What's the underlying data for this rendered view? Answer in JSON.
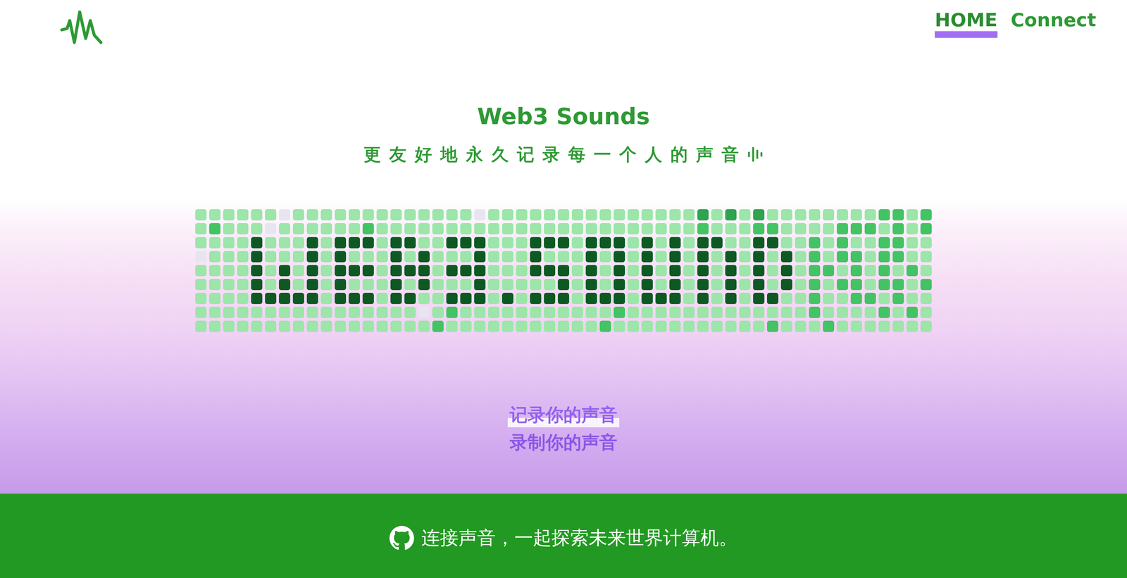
{
  "header": {
    "nav": [
      {
        "label": "HOME",
        "selected": true
      },
      {
        "label": "Connect",
        "selected": false
      }
    ]
  },
  "hero": {
    "title": "Web3 Sounds",
    "subtitle": "更友好地永久记录每一个人的声音"
  },
  "grid": {
    "levels": [
      [
        1,
        1,
        1,
        1,
        1,
        1,
        0,
        1,
        1,
        1,
        1,
        1,
        1,
        1,
        1,
        1,
        1,
        1,
        1,
        1,
        0,
        1,
        1,
        1,
        1,
        1,
        1,
        1,
        1,
        1,
        1,
        1,
        1,
        1,
        1,
        1,
        3,
        1,
        3,
        1,
        3,
        1,
        1,
        1,
        1,
        1,
        1,
        1,
        1,
        2,
        2,
        1,
        2
      ],
      [
        1,
        2,
        1,
        1,
        1,
        0,
        1,
        1,
        1,
        1,
        1,
        1,
        2,
        1,
        1,
        1,
        1,
        1,
        1,
        1,
        1,
        1,
        1,
        1,
        1,
        1,
        1,
        1,
        1,
        1,
        1,
        1,
        1,
        1,
        1,
        1,
        2,
        1,
        1,
        1,
        2,
        2,
        1,
        1,
        1,
        1,
        2,
        2,
        2,
        1,
        2,
        1,
        2
      ],
      [
        1,
        1,
        1,
        1,
        4,
        1,
        1,
        1,
        4,
        1,
        4,
        4,
        4,
        1,
        4,
        4,
        1,
        1,
        4,
        4,
        4,
        1,
        1,
        1,
        4,
        4,
        4,
        1,
        4,
        4,
        4,
        1,
        4,
        1,
        4,
        1,
        4,
        4,
        1,
        1,
        4,
        4,
        1,
        1,
        2,
        1,
        2,
        1,
        1,
        2,
        2,
        1,
        1
      ],
      [
        0,
        1,
        1,
        1,
        4,
        1,
        1,
        1,
        4,
        1,
        4,
        1,
        1,
        1,
        4,
        1,
        4,
        1,
        1,
        1,
        4,
        1,
        1,
        1,
        4,
        1,
        1,
        1,
        4,
        1,
        4,
        1,
        4,
        1,
        4,
        1,
        4,
        1,
        4,
        1,
        4,
        1,
        4,
        1,
        2,
        1,
        2,
        2,
        1,
        2,
        2,
        1,
        1
      ],
      [
        1,
        1,
        1,
        1,
        4,
        1,
        4,
        1,
        4,
        1,
        4,
        4,
        4,
        1,
        4,
        4,
        4,
        1,
        4,
        4,
        4,
        1,
        1,
        1,
        4,
        4,
        4,
        1,
        4,
        1,
        4,
        1,
        4,
        1,
        4,
        1,
        4,
        1,
        4,
        1,
        4,
        1,
        4,
        1,
        2,
        2,
        1,
        2,
        1,
        2,
        1,
        2,
        1
      ],
      [
        1,
        1,
        1,
        1,
        4,
        1,
        4,
        1,
        4,
        1,
        4,
        1,
        1,
        1,
        4,
        1,
        4,
        1,
        1,
        1,
        4,
        1,
        1,
        1,
        1,
        1,
        4,
        1,
        4,
        1,
        4,
        1,
        4,
        1,
        4,
        1,
        4,
        1,
        4,
        1,
        4,
        1,
        4,
        1,
        2,
        1,
        2,
        2,
        1,
        2,
        2,
        1,
        2
      ],
      [
        1,
        1,
        1,
        1,
        4,
        4,
        4,
        4,
        4,
        1,
        4,
        4,
        4,
        1,
        4,
        4,
        1,
        1,
        4,
        4,
        4,
        1,
        4,
        1,
        4,
        4,
        4,
        1,
        4,
        4,
        4,
        1,
        4,
        4,
        4,
        1,
        4,
        1,
        4,
        1,
        4,
        4,
        1,
        1,
        2,
        1,
        1,
        2,
        2,
        1,
        2,
        1,
        1
      ],
      [
        1,
        1,
        1,
        1,
        1,
        1,
        1,
        1,
        1,
        1,
        1,
        1,
        1,
        1,
        1,
        1,
        0,
        1,
        2,
        1,
        1,
        1,
        1,
        1,
        1,
        1,
        1,
        1,
        1,
        1,
        2,
        1,
        1,
        1,
        1,
        1,
        1,
        1,
        1,
        1,
        1,
        1,
        1,
        1,
        2,
        1,
        1,
        1,
        1,
        2,
        1,
        2,
        1
      ],
      [
        1,
        1,
        1,
        1,
        1,
        1,
        1,
        1,
        1,
        1,
        1,
        1,
        1,
        1,
        1,
        1,
        1,
        2,
        1,
        1,
        1,
        1,
        1,
        1,
        1,
        1,
        1,
        1,
        1,
        2,
        1,
        1,
        1,
        1,
        1,
        1,
        1,
        1,
        1,
        1,
        1,
        2,
        1,
        1,
        1,
        2,
        1,
        1,
        1,
        1,
        1,
        1,
        1
      ]
    ]
  },
  "actions": [
    {
      "label": "记录你的声音",
      "selected": true
    },
    {
      "label": "录制你的声音",
      "selected": false
    }
  ],
  "footer": {
    "text": "连接声音，一起探索未来世界计算机。"
  }
}
